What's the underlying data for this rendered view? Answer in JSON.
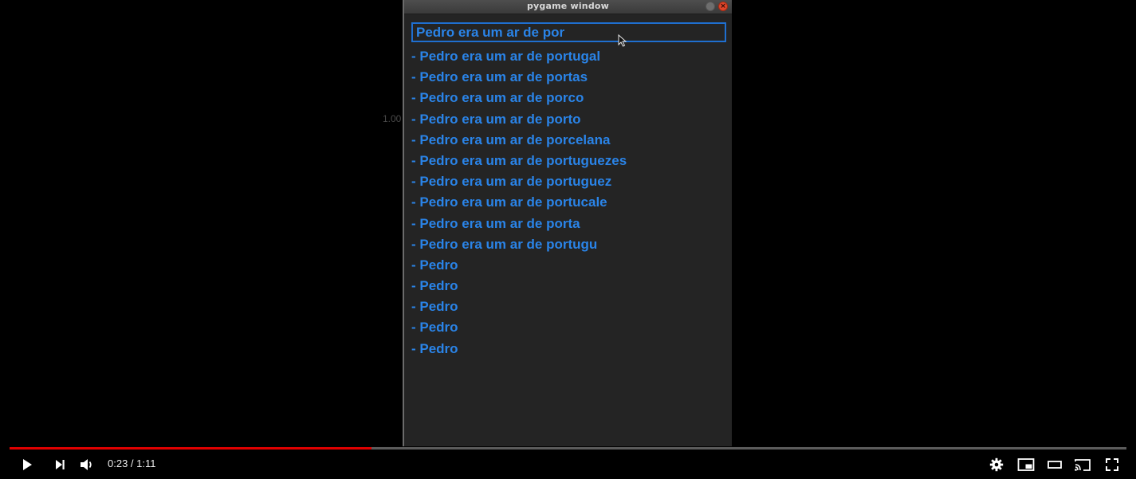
{
  "background": {
    "axis_label": "1.00"
  },
  "pygame_window": {
    "title": "pygame window",
    "input_value": "Pedro era um ar de por",
    "text_color": "#2a84e8",
    "input_border_color": "#1f6fd0",
    "suggestions": [
      "- Pedro era um ar de portugal",
      "- Pedro era um ar de portas",
      "- Pedro era um ar de porco",
      "- Pedro era um ar de porto",
      "- Pedro era um ar de porcelana",
      "- Pedro era um ar de portuguezes",
      "- Pedro era um ar de portuguez",
      "- Pedro era um ar de portucale",
      "- Pedro era um ar de porta",
      "- Pedro era um ar de portugu",
      "- Pedro",
      "- Pedro",
      "- Pedro",
      "- Pedro",
      "- Pedro"
    ]
  },
  "player": {
    "time_display": "0:23 / 1:11",
    "progress_fraction": 0.324,
    "progress_color": "#e00000",
    "left_controls": [
      "play-icon",
      "next-icon",
      "volume-icon"
    ],
    "right_controls": [
      "settings-icon",
      "miniplayer-icon",
      "theater-mode-icon",
      "cast-icon",
      "fullscreen-icon"
    ]
  }
}
